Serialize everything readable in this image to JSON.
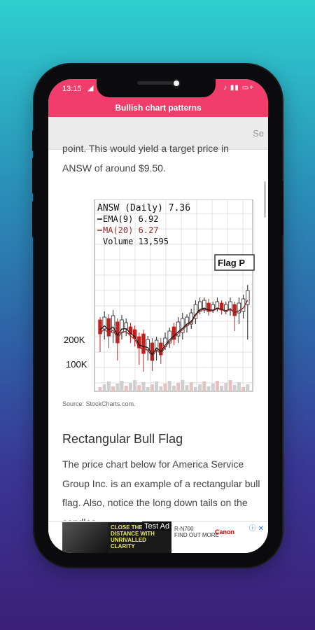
{
  "status_bar": {
    "time": "13:15",
    "right_icons": "♪ ▮▮ ▭+"
  },
  "app_bar": {
    "title": "Bullish chart patterns"
  },
  "search": {
    "hint": "Se"
  },
  "article": {
    "cut_line": "point. This would yield a target price in",
    "p1": "ANSW of around $9.50.",
    "source": "Source: StockCharts.com.",
    "heading": "Rectangular Bull Flag",
    "para": "The price chart below for America Service Group Inc. is an example of a rectangular bull flag. Also, notice the long down tails on the candles"
  },
  "chart_image": {
    "title": "ANSW (Daily) 7.36",
    "ema": "EMA(9) 6.92",
    "ma": "MA(20) 6.27",
    "volume": "Volume 13,595",
    "flag_label": "Flag P",
    "vol_ticks": [
      "200K",
      "100K"
    ],
    "colors": {
      "up": "#222222",
      "down": "#c0201e",
      "ema": "#111111",
      "ma": "#9b2a2a"
    }
  },
  "ad": {
    "badge": "Test Ad",
    "headline": "CLOSE THE DISTANCE WITH UNRIVALLED CLARITY",
    "product": "R-N700",
    "cta": "FIND OUT MORE",
    "brand": "Canon"
  }
}
